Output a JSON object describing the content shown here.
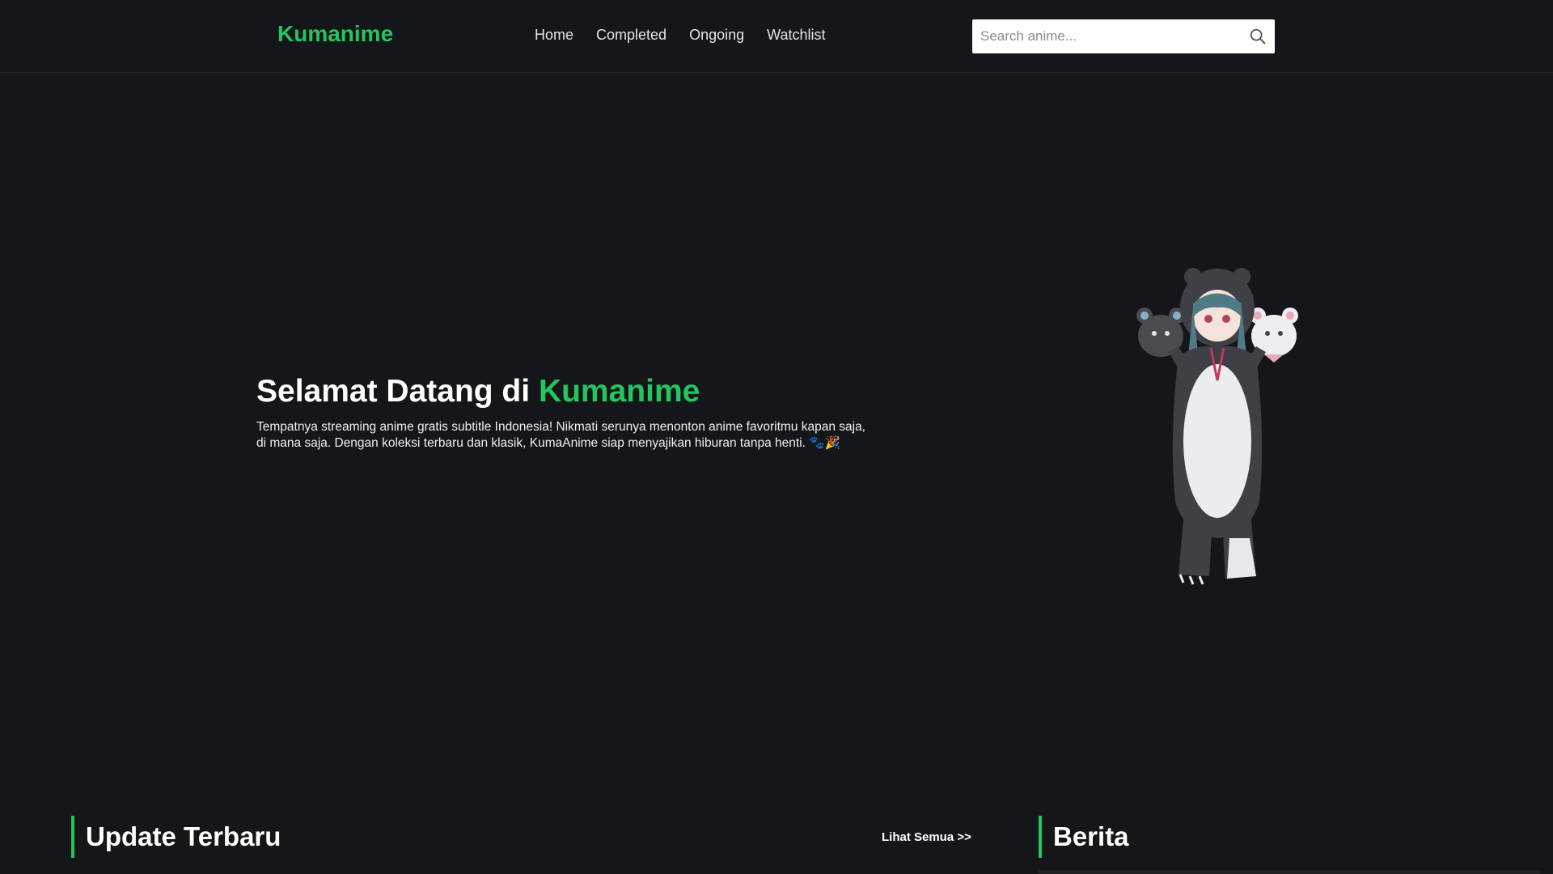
{
  "navbar": {
    "logo": "Kumanime",
    "links": [
      "Home",
      "Completed",
      "Ongoing",
      "Watchlist"
    ],
    "search": {
      "placeholder": "Search anime...",
      "value": "",
      "icon": "search-icon"
    }
  },
  "hero": {
    "title_prefix": "Selamat Datang di ",
    "title_brand": "Kumanime",
    "description": "Tempatnya streaming anime gratis subtitle Indonesia! Nikmati serunya menonton anime favoritmu kapan saja, di mana saja. Dengan koleksi terbaru dan klasik, KumaAnime siap menyajikan hiburan tanpa henti. 🐾🎉",
    "mascot": "bear-costume-anime-girl"
  },
  "sections": {
    "latest": {
      "title": "Update Terbaru",
      "see_all": "Lihat Semua >>"
    },
    "news": {
      "title": "Berita"
    }
  },
  "colors": {
    "background": "#15161a",
    "accent": "#22c55e",
    "text": "#ffffff"
  }
}
